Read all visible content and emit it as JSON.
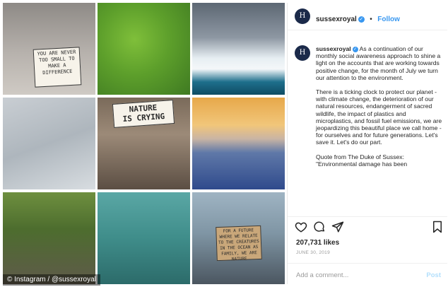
{
  "grid": {
    "tiles": [
      {
        "id": "t1",
        "subject": "child-with-sign"
      },
      {
        "id": "t2",
        "subject": "aerial-herd"
      },
      {
        "id": "t3",
        "subject": "penguins-iceberg"
      },
      {
        "id": "t4",
        "subject": "plastic-bottles"
      },
      {
        "id": "t5",
        "subject": "child-protest-sign"
      },
      {
        "id": "t6",
        "subject": "couple-on-ice"
      },
      {
        "id": "t7",
        "subject": "schoolchildren"
      },
      {
        "id": "t8",
        "subject": "sea-turtle"
      },
      {
        "id": "t9",
        "subject": "woman-with-sign"
      }
    ],
    "sign1": "YOU ARE NEVER\nTOO SMALL TO\nMAKE A\nDIFFERENCE",
    "sign5": "NATURE\nIS CRYING",
    "sign9": "FOR A FUTURE\nWHERE WE RELATE\nTO THE CREATURES\nIN THE OCEAN AS\nFAMILY, WE ARE\nNATURE"
  },
  "watermark": "© Instagram / @sussexroyal",
  "header": {
    "avatar_letter": "H",
    "username": "sussexroyal",
    "separator": "•",
    "follow_label": "Follow"
  },
  "caption": {
    "username": "sussexroyal",
    "p1": "As a continuation of our monthly social awareness approach to shine a light on the accounts that are working towards positive change, for the month of July we turn our attention to the environment.",
    "p2": "There is a ticking clock to protect our planet - with climate change, the deterioration of our natural resources, endangerment of sacred wildlife, the impact of plastics and microplastics, and fossil fuel emissions, we are jeopardizing this beautiful place we call home - for ourselves and for future generations. Let's save it. Let's do our part.",
    "p3": "Quote from The Duke of Sussex: \"Environmental damage has been"
  },
  "stats": {
    "likes": "207,731 likes",
    "date": "JUNE 30, 2019"
  },
  "comment": {
    "placeholder": "Add a comment...",
    "post_label": "Post"
  },
  "icons": {
    "like": "heart-icon",
    "comment": "comment-icon",
    "share": "share-icon",
    "save": "bookmark-icon",
    "verified": "verified-badge-icon"
  },
  "colors": {
    "accent": "#3897f0",
    "text": "#262626",
    "muted": "#9a9a9a"
  }
}
